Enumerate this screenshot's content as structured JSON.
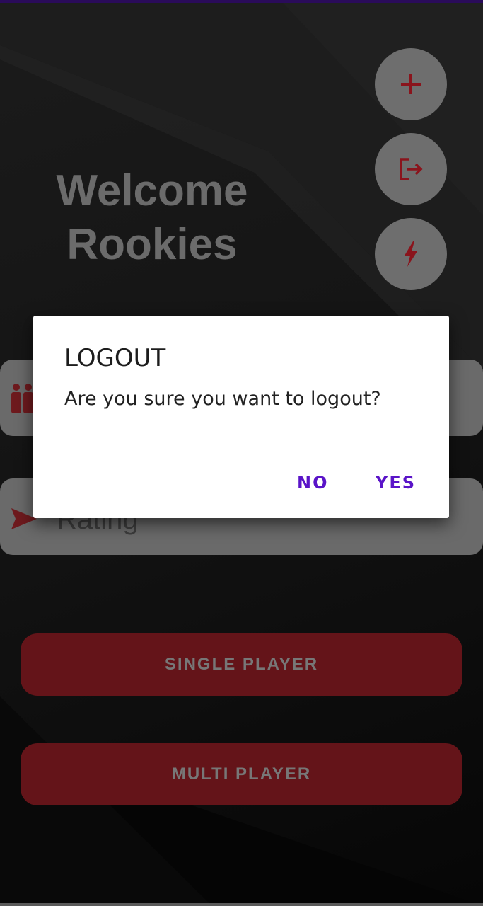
{
  "colors": {
    "accent": "#5a14c8",
    "brand_red": "#641419",
    "icon_red": "#8a141c",
    "fab_bg": "#6e6e6e"
  },
  "fabs": [
    {
      "name": "add",
      "icon": "plus-icon"
    },
    {
      "name": "logout",
      "icon": "logout-icon"
    },
    {
      "name": "flash",
      "icon": "lightning-icon"
    }
  ],
  "welcome": {
    "line1": "Welcome",
    "line2": "Rookies"
  },
  "fields": {
    "players_icon": "people-icon",
    "rating_icon": "send-icon",
    "rating_label": "Rating"
  },
  "buttons": {
    "single_player": "SINGLE PLAYER",
    "multi_player": "MULTI PLAYER"
  },
  "dialog": {
    "title": "LOGOUT",
    "message": "Are you sure you want to logout?",
    "no_label": "NO",
    "yes_label": "YES"
  }
}
